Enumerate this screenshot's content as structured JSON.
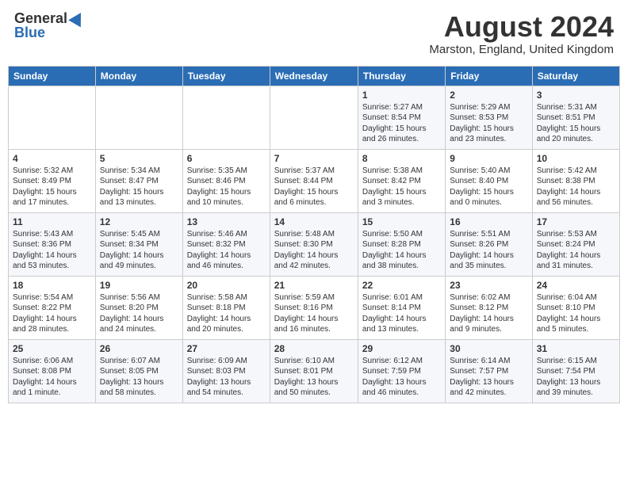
{
  "header": {
    "logo_general": "General",
    "logo_blue": "Blue",
    "month_title": "August 2024",
    "location": "Marston, England, United Kingdom"
  },
  "weekdays": [
    "Sunday",
    "Monday",
    "Tuesday",
    "Wednesday",
    "Thursday",
    "Friday",
    "Saturday"
  ],
  "weeks": [
    [
      {
        "day": "",
        "info": ""
      },
      {
        "day": "",
        "info": ""
      },
      {
        "day": "",
        "info": ""
      },
      {
        "day": "",
        "info": ""
      },
      {
        "day": "1",
        "info": "Sunrise: 5:27 AM\nSunset: 8:54 PM\nDaylight: 15 hours\nand 26 minutes."
      },
      {
        "day": "2",
        "info": "Sunrise: 5:29 AM\nSunset: 8:53 PM\nDaylight: 15 hours\nand 23 minutes."
      },
      {
        "day": "3",
        "info": "Sunrise: 5:31 AM\nSunset: 8:51 PM\nDaylight: 15 hours\nand 20 minutes."
      }
    ],
    [
      {
        "day": "4",
        "info": "Sunrise: 5:32 AM\nSunset: 8:49 PM\nDaylight: 15 hours\nand 17 minutes."
      },
      {
        "day": "5",
        "info": "Sunrise: 5:34 AM\nSunset: 8:47 PM\nDaylight: 15 hours\nand 13 minutes."
      },
      {
        "day": "6",
        "info": "Sunrise: 5:35 AM\nSunset: 8:46 PM\nDaylight: 15 hours\nand 10 minutes."
      },
      {
        "day": "7",
        "info": "Sunrise: 5:37 AM\nSunset: 8:44 PM\nDaylight: 15 hours\nand 6 minutes."
      },
      {
        "day": "8",
        "info": "Sunrise: 5:38 AM\nSunset: 8:42 PM\nDaylight: 15 hours\nand 3 minutes."
      },
      {
        "day": "9",
        "info": "Sunrise: 5:40 AM\nSunset: 8:40 PM\nDaylight: 15 hours\nand 0 minutes."
      },
      {
        "day": "10",
        "info": "Sunrise: 5:42 AM\nSunset: 8:38 PM\nDaylight: 14 hours\nand 56 minutes."
      }
    ],
    [
      {
        "day": "11",
        "info": "Sunrise: 5:43 AM\nSunset: 8:36 PM\nDaylight: 14 hours\nand 53 minutes."
      },
      {
        "day": "12",
        "info": "Sunrise: 5:45 AM\nSunset: 8:34 PM\nDaylight: 14 hours\nand 49 minutes."
      },
      {
        "day": "13",
        "info": "Sunrise: 5:46 AM\nSunset: 8:32 PM\nDaylight: 14 hours\nand 46 minutes."
      },
      {
        "day": "14",
        "info": "Sunrise: 5:48 AM\nSunset: 8:30 PM\nDaylight: 14 hours\nand 42 minutes."
      },
      {
        "day": "15",
        "info": "Sunrise: 5:50 AM\nSunset: 8:28 PM\nDaylight: 14 hours\nand 38 minutes."
      },
      {
        "day": "16",
        "info": "Sunrise: 5:51 AM\nSunset: 8:26 PM\nDaylight: 14 hours\nand 35 minutes."
      },
      {
        "day": "17",
        "info": "Sunrise: 5:53 AM\nSunset: 8:24 PM\nDaylight: 14 hours\nand 31 minutes."
      }
    ],
    [
      {
        "day": "18",
        "info": "Sunrise: 5:54 AM\nSunset: 8:22 PM\nDaylight: 14 hours\nand 28 minutes."
      },
      {
        "day": "19",
        "info": "Sunrise: 5:56 AM\nSunset: 8:20 PM\nDaylight: 14 hours\nand 24 minutes."
      },
      {
        "day": "20",
        "info": "Sunrise: 5:58 AM\nSunset: 8:18 PM\nDaylight: 14 hours\nand 20 minutes."
      },
      {
        "day": "21",
        "info": "Sunrise: 5:59 AM\nSunset: 8:16 PM\nDaylight: 14 hours\nand 16 minutes."
      },
      {
        "day": "22",
        "info": "Sunrise: 6:01 AM\nSunset: 8:14 PM\nDaylight: 14 hours\nand 13 minutes."
      },
      {
        "day": "23",
        "info": "Sunrise: 6:02 AM\nSunset: 8:12 PM\nDaylight: 14 hours\nand 9 minutes."
      },
      {
        "day": "24",
        "info": "Sunrise: 6:04 AM\nSunset: 8:10 PM\nDaylight: 14 hours\nand 5 minutes."
      }
    ],
    [
      {
        "day": "25",
        "info": "Sunrise: 6:06 AM\nSunset: 8:08 PM\nDaylight: 14 hours\nand 1 minute."
      },
      {
        "day": "26",
        "info": "Sunrise: 6:07 AM\nSunset: 8:05 PM\nDaylight: 13 hours\nand 58 minutes."
      },
      {
        "day": "27",
        "info": "Sunrise: 6:09 AM\nSunset: 8:03 PM\nDaylight: 13 hours\nand 54 minutes."
      },
      {
        "day": "28",
        "info": "Sunrise: 6:10 AM\nSunset: 8:01 PM\nDaylight: 13 hours\nand 50 minutes."
      },
      {
        "day": "29",
        "info": "Sunrise: 6:12 AM\nSunset: 7:59 PM\nDaylight: 13 hours\nand 46 minutes."
      },
      {
        "day": "30",
        "info": "Sunrise: 6:14 AM\nSunset: 7:57 PM\nDaylight: 13 hours\nand 42 minutes."
      },
      {
        "day": "31",
        "info": "Sunrise: 6:15 AM\nSunset: 7:54 PM\nDaylight: 13 hours\nand 39 minutes."
      }
    ]
  ]
}
